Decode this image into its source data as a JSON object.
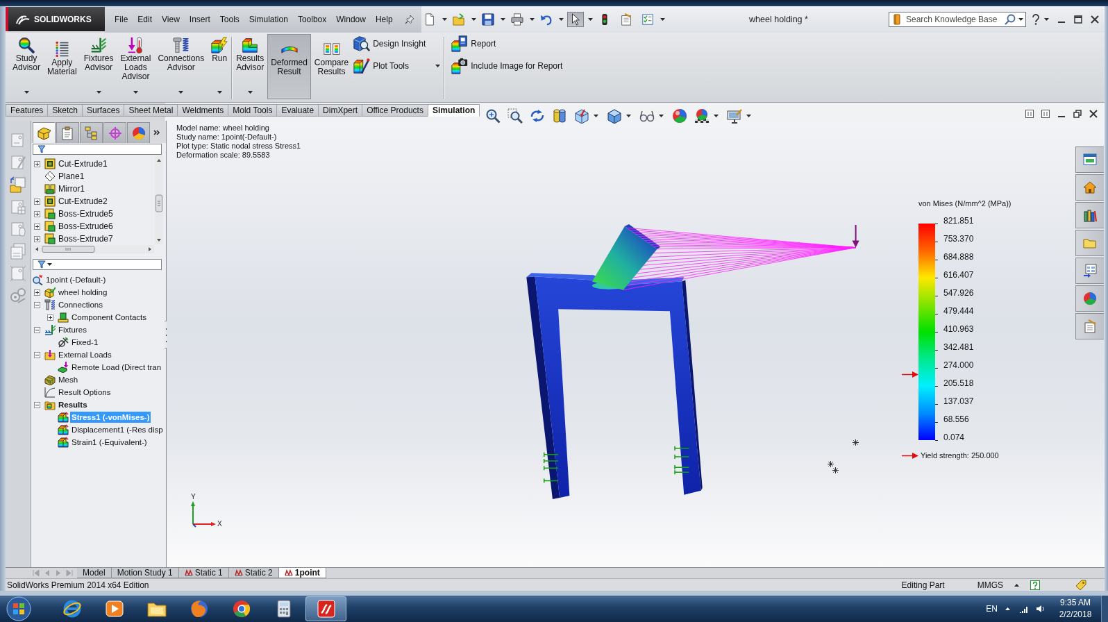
{
  "window": {
    "logo": "SOLIDWORKS",
    "menu": [
      "File",
      "Edit",
      "View",
      "Insert",
      "Tools",
      "Simulation",
      "Toolbox",
      "Window",
      "Help"
    ],
    "title": "wheel holding *",
    "search": {
      "placeholder": "Search Knowledge Base"
    }
  },
  "quick_access": [
    {
      "kind": "new",
      "dropdown": true,
      "selected": false
    },
    {
      "kind": "open",
      "dropdown": true,
      "selected": false
    },
    {
      "kind": "save",
      "dropdown": true,
      "selected": false
    },
    {
      "kind": "print",
      "dropdown": true,
      "selected": false
    },
    {
      "kind": "undo",
      "dropdown": true,
      "selected": false
    },
    {
      "kind": "select",
      "dropdown": true,
      "selected": true
    },
    {
      "kind": "rebuild",
      "dropdown": false,
      "selected": false
    },
    {
      "kind": "options",
      "dropdown": false,
      "selected": false
    },
    {
      "kind": "checklist",
      "dropdown": true,
      "selected": false
    }
  ],
  "ribbon": [
    {
      "large": [
        {
          "lines": [
            "Study",
            "Advisor"
          ],
          "kind": "advisor",
          "dropdown": true,
          "selected": false
        },
        {
          "lines": [
            "Apply",
            "Material"
          ],
          "kind": "material",
          "dropdown": false,
          "selected": false
        },
        {
          "lines": [
            "Fixtures",
            "Advisor"
          ],
          "kind": "fixtures",
          "dropdown": true,
          "selected": false
        },
        {
          "lines": [
            "External",
            "Loads",
            "Advisor"
          ],
          "kind": "loads",
          "dropdown": true,
          "selected": false
        },
        {
          "lines": [
            "Connections",
            "Advisor"
          ],
          "kind": "connections",
          "dropdown": true,
          "selected": false
        },
        {
          "lines": [
            "Run"
          ],
          "kind": "run",
          "dropdown": true,
          "selected": false
        }
      ]
    },
    {
      "large": [
        {
          "lines": [
            "Results",
            "Advisor"
          ],
          "kind": "results",
          "dropdown": true,
          "selected": false
        },
        {
          "lines": [
            "Deformed",
            "Result"
          ],
          "kind": "deformed",
          "dropdown": false,
          "selected": true
        },
        {
          "lines": [
            "Compare",
            "Results"
          ],
          "kind": "compare",
          "dropdown": false,
          "selected": false
        }
      ],
      "small": [
        {
          "label": "Design Insight",
          "kind": "insight",
          "dropdown": false,
          "selected": false
        },
        {
          "label": "Plot Tools",
          "kind": "plottools",
          "dropdown": true,
          "selected": false
        }
      ]
    },
    {
      "small": [
        {
          "label": "Report",
          "kind": "report",
          "dropdown": false,
          "selected": false
        },
        {
          "label": "Include Image for Report",
          "kind": "image",
          "dropdown": false,
          "selected": false
        }
      ]
    }
  ],
  "command_tabs": [
    {
      "label": "Features",
      "selected": false
    },
    {
      "label": "Sketch",
      "selected": false
    },
    {
      "label": "Surfaces",
      "selected": false
    },
    {
      "label": "Sheet Metal",
      "selected": false
    },
    {
      "label": "Weldments",
      "selected": false
    },
    {
      "label": "Mold Tools",
      "selected": false
    },
    {
      "label": "Evaluate",
      "selected": false
    },
    {
      "label": "DimXpert",
      "selected": false
    },
    {
      "label": "Office Products",
      "selected": false
    },
    {
      "label": "Simulation",
      "selected": true
    }
  ],
  "feature_manager": {
    "tabs": [
      {
        "kind": "features",
        "selected": true
      },
      {
        "kind": "properties",
        "selected": false
      },
      {
        "kind": "configurations",
        "selected": false
      },
      {
        "kind": "dimxpert",
        "selected": false
      },
      {
        "kind": "display",
        "selected": false
      }
    ],
    "features": [
      {
        "label": "Cut-Extrude1",
        "kind": "cut",
        "expanded": false
      },
      {
        "label": "Plane1",
        "kind": "plane"
      },
      {
        "label": "Mirror1",
        "kind": "mirror"
      },
      {
        "label": "Cut-Extrude2",
        "kind": "cut",
        "expanded": false
      },
      {
        "label": "Boss-Extrude5",
        "kind": "boss",
        "expanded": false
      },
      {
        "label": "Boss-Extrude6",
        "kind": "boss",
        "expanded": false
      },
      {
        "label": "Boss-Extrude7",
        "kind": "boss",
        "expanded": false
      }
    ],
    "study_tree": [
      {
        "label": "1point (-Default-)",
        "kind": "study",
        "selected": false,
        "active": false,
        "children": [
          {
            "label": "wheel holding",
            "kind": "part",
            "expanded": false,
            "selected": false,
            "active": false
          },
          {
            "label": "Connections",
            "kind": "connections",
            "expanded": true,
            "selected": false,
            "active": false,
            "children": [
              {
                "label": "Component Contacts",
                "kind": "contacts",
                "expanded": false,
                "selected": false,
                "active": false
              }
            ]
          },
          {
            "label": "Fixtures",
            "kind": "fixtures",
            "expanded": true,
            "selected": false,
            "active": false,
            "children": [
              {
                "label": "Fixed-1",
                "kind": "fixture",
                "selected": false,
                "active": false
              }
            ]
          },
          {
            "label": "External Loads",
            "kind": "loads",
            "expanded": true,
            "selected": false,
            "active": false,
            "children": [
              {
                "label": "Remote Load (Direct tran",
                "kind": "load",
                "selected": false,
                "active": false
              }
            ]
          },
          {
            "label": "Mesh",
            "kind": "mesh",
            "selected": false,
            "active": false
          },
          {
            "label": "Result Options",
            "kind": "resultoptions",
            "selected": false,
            "active": false
          },
          {
            "label": "Results",
            "kind": "results",
            "expanded": true,
            "selected": false,
            "active": true,
            "children": [
              {
                "label": "Stress1 (-vonMises-)",
                "kind": "stress",
                "selected": true,
                "active": true
              },
              {
                "label": "Displacement1 (-Res disp",
                "kind": "displacement",
                "selected": false,
                "active": false
              },
              {
                "label": "Strain1 (-Equivalent-)",
                "kind": "strain",
                "selected": false,
                "active": false
              }
            ]
          }
        ]
      }
    ]
  },
  "graphics": {
    "info": [
      "Model name: wheel holding",
      "Study name: 1point(-Default-)",
      "Plot type: Static nodal stress Stress1",
      "Deformation scale: 89.5583"
    ],
    "legend": {
      "title": "von Mises (N/mm^2 (MPa))",
      "ticks": [
        "821.851",
        "753.370",
        "684.888",
        "616.407",
        "547.926",
        "479.444",
        "410.963",
        "342.481",
        "274.000",
        "205.518",
        "137.037",
        "68.556",
        "0.074"
      ],
      "yield": {
        "label": "Yield strength: 250.000",
        "level": 0.304
      }
    },
    "triad": {
      "y": "Y",
      "x": "X"
    }
  },
  "bottom_tabs": [
    {
      "label": "Model",
      "kind": "model",
      "selected": false
    },
    {
      "label": "Motion Study 1",
      "kind": "motion",
      "selected": false
    },
    {
      "label": "Static 1",
      "kind": "study",
      "selected": false
    },
    {
      "label": "Static 2",
      "kind": "study",
      "selected": false
    },
    {
      "label": "1point",
      "kind": "study",
      "selected": true
    }
  ],
  "status_bar": {
    "edition": "SolidWorks Premium 2014 x64 Edition",
    "mode": "Editing Part",
    "units": "MMGS"
  },
  "taskbar": {
    "apps": [
      {
        "kind": "ie",
        "selected": false
      },
      {
        "kind": "media",
        "selected": false
      },
      {
        "kind": "files",
        "selected": false
      },
      {
        "kind": "firefox",
        "selected": false
      },
      {
        "kind": "chrome",
        "selected": false
      },
      {
        "kind": "calculator",
        "selected": false
      },
      {
        "kind": "solidworks",
        "selected": true
      }
    ],
    "language": "EN",
    "time": "9:35 AM",
    "date": "2/2/2018"
  }
}
